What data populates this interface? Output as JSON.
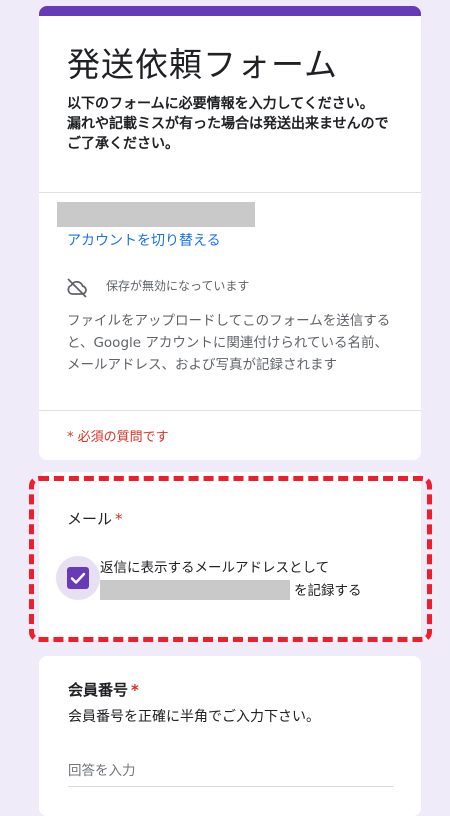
{
  "form": {
    "title": "発送依頼フォーム",
    "description": "以下のフォームに必要情報を入力してください。\n漏れや記載ミスが有った場合は発送出来ませんのでご了承ください。",
    "accent_color": "#673ab7",
    "background_color": "#f0ebf8"
  },
  "account": {
    "switch_label": "アカウントを切り替える",
    "saving_status": "保存が無効になっています",
    "upload_note": "ファイルをアップロードしてこのフォームを送信すると、Google アカウントに関連付けられている名前、メールアドレス、および写真が記録されます",
    "required_note": "* 必須の質問です"
  },
  "email_question": {
    "label": "メール",
    "required_mark": "*",
    "checkbox_text": "返信に表示するメールアドレスとして",
    "checkbox_suffix": "を記録する",
    "checked": true
  },
  "member_question": {
    "label": "会員番号",
    "required_mark": "*",
    "help": "会員番号を正確に半角でご入力下さい。",
    "placeholder": "回答を入力"
  },
  "icons": {
    "saving": "cloud-off-icon",
    "checkbox": "check-icon"
  }
}
